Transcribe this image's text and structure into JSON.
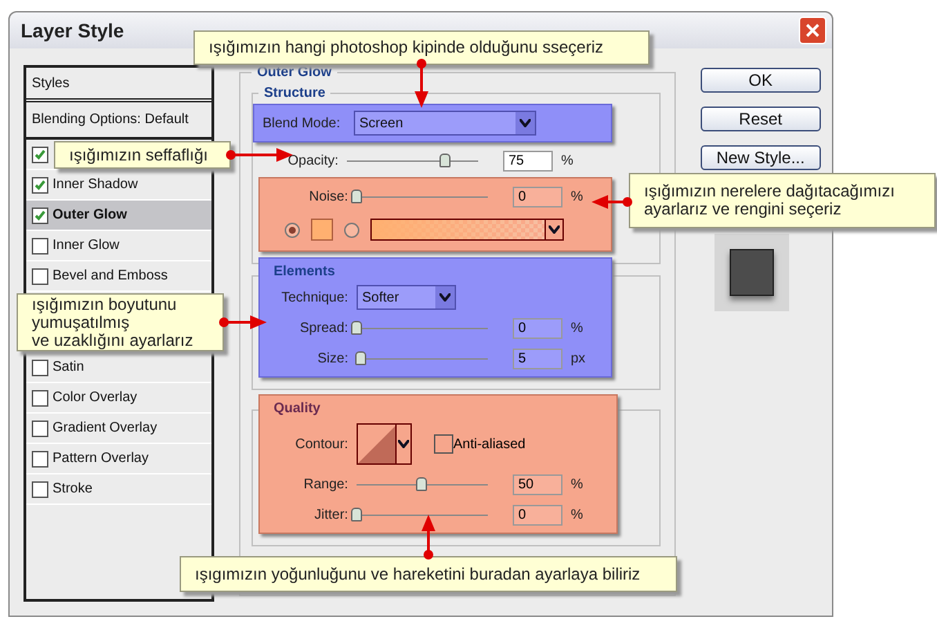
{
  "window": {
    "title": "Layer Style"
  },
  "styles_list": {
    "header": "Styles",
    "blending": "Blending Options: Default",
    "items": [
      {
        "checked": true,
        "selected": false
      },
      {
        "label": "Inner Shadow",
        "checked": true,
        "selected": false
      },
      {
        "label": "Outer Glow",
        "checked": true,
        "selected": true
      },
      {
        "label": "Inner Glow",
        "checked": false,
        "selected": false
      },
      {
        "label": "Bevel and Emboss",
        "checked": false,
        "selected": false
      },
      {
        "label": "Satin",
        "checked": false,
        "selected": false
      },
      {
        "label": "Color Overlay",
        "checked": false,
        "selected": false
      },
      {
        "label": "Gradient Overlay",
        "checked": false,
        "selected": false
      },
      {
        "label": "Pattern Overlay",
        "checked": false,
        "selected": false
      },
      {
        "label": "Stroke",
        "checked": false,
        "selected": false
      }
    ]
  },
  "outer_glow": {
    "title": "Outer Glow",
    "structure": {
      "title": "Structure",
      "blend_mode": {
        "label": "Blend Mode:",
        "value": "Screen"
      },
      "opacity": {
        "label": "Opacity:",
        "level": 0.75,
        "value": "75",
        "unit": "%"
      },
      "noise": {
        "label": "Noise:",
        "level": 0,
        "value": "0",
        "unit": "%"
      },
      "color_options": [
        {
          "selected": true,
          "kind": "solid"
        },
        {
          "selected": false,
          "kind": "gradient"
        }
      ]
    },
    "elements": {
      "title": "Elements",
      "technique": {
        "label": "Technique:",
        "value": "Softer"
      },
      "spread": {
        "label": "Spread:",
        "level": 0,
        "value": "0",
        "unit": "%"
      },
      "size": {
        "label": "Size:",
        "level": 0.03,
        "value": "5",
        "unit": "px"
      }
    },
    "quality": {
      "title": "Quality",
      "contour_label": "Contour:",
      "anti_aliased": {
        "label": "Anti-aliased",
        "checked": false
      },
      "range": {
        "label": "Range:",
        "level": 0.5,
        "value": "50",
        "unit": "%"
      },
      "jitter": {
        "label": "Jitter:",
        "level": 0,
        "value": "0",
        "unit": "%"
      }
    }
  },
  "buttons": [
    "OK",
    "Reset",
    "New Style..."
  ],
  "callouts": [
    {
      "text": "ışığımızın hangi photoshop kipinde olduğunu sseçeriz"
    },
    {
      "text": "ışığımızın seffaflığı"
    },
    {
      "text": "ışığımızın nerelere dağıtacağımızı\nayarlarız ve rengini seçeriz"
    },
    {
      "text": "ışığımızın boyutunu\n yumuşatılmış\nve uzaklığını ayarlarız"
    },
    {
      "text": "ışıgımızın yoğunluğunu ve hareketini buradan ayarlaya biliriz"
    }
  ]
}
